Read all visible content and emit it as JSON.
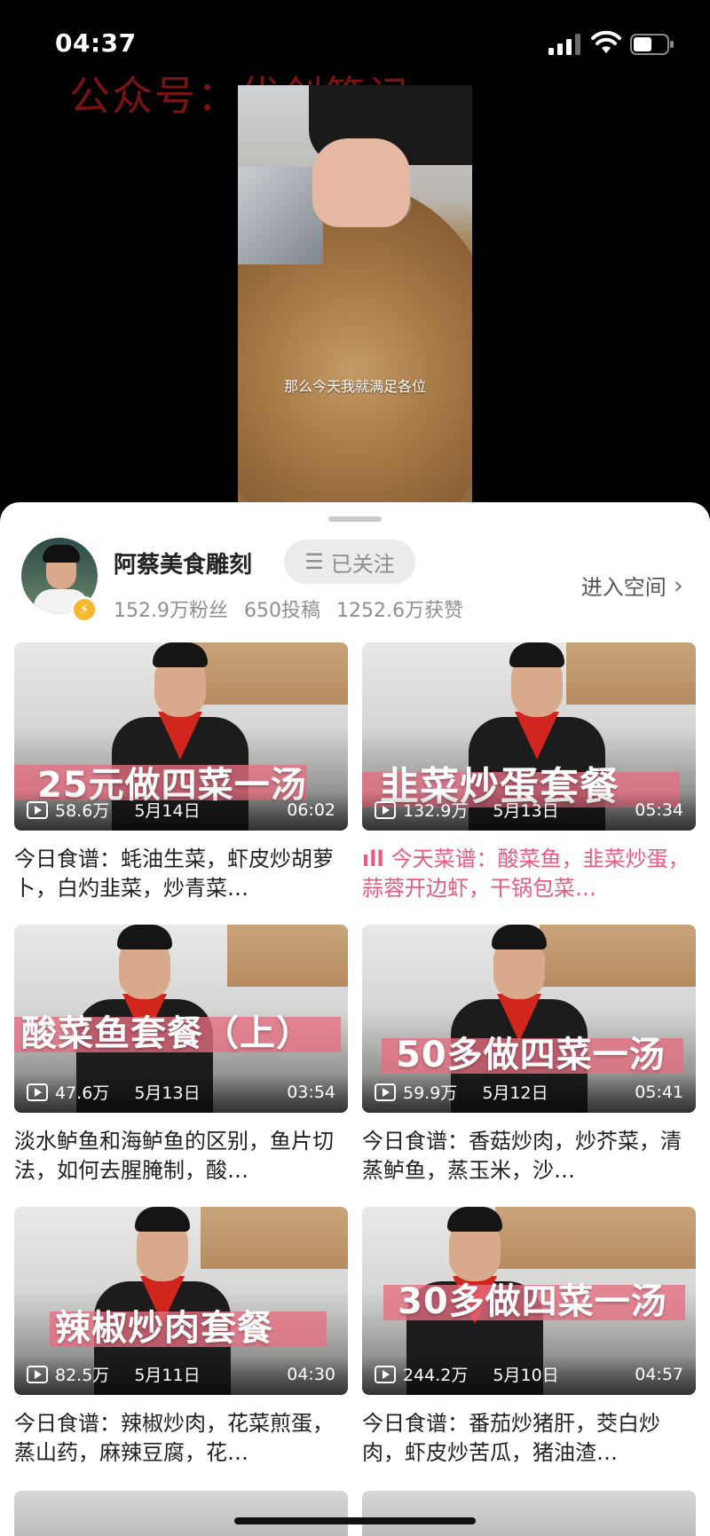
{
  "status": {
    "time": "04:37"
  },
  "watermark": "公众号：优创笔记",
  "video": {
    "subtitle": "那么今天我就满足各位"
  },
  "channel": {
    "name": "阿蔡美食雕刻",
    "follow_label": "已关注",
    "followers": "152.9万粉丝",
    "posts": "650投稿",
    "likes": "1252.6万获赞",
    "enter_space": "进入空间"
  },
  "videos": [
    {
      "overlay": "25元做四菜一汤",
      "views": "58.6万",
      "date": "5月14日",
      "duration": "06:02",
      "caption": "今日食谱：蚝油生菜，虾皮炒胡萝卜，白灼韭菜，炒青菜…",
      "active": false
    },
    {
      "overlay": "韭菜炒蛋套餐",
      "views": "132.9万",
      "date": "5月13日",
      "duration": "05:34",
      "caption": "今天菜谱：酸菜鱼，韭菜炒蛋，蒜蓉开边虾，干锅包菜…",
      "active": true
    },
    {
      "overlay": "酸菜鱼套餐（上）",
      "views": "47.6万",
      "date": "5月13日",
      "duration": "03:54",
      "caption": "淡水鲈鱼和海鲈鱼的区别，鱼片切法，如何去腥腌制，酸…",
      "active": false
    },
    {
      "overlay": "50多做四菜一汤",
      "views": "59.9万",
      "date": "5月12日",
      "duration": "05:41",
      "caption": "今日食谱：香菇炒肉，炒芥菜，清蒸鲈鱼，蒸玉米，沙…",
      "active": false
    },
    {
      "overlay": "辣椒炒肉套餐",
      "views": "82.5万",
      "date": "5月11日",
      "duration": "04:30",
      "caption": "今日食谱：辣椒炒肉，花菜煎蛋，蒸山药，麻辣豆腐，花…",
      "active": false
    },
    {
      "overlay": "30多做四菜一汤",
      "views": "244.2万",
      "date": "5月10日",
      "duration": "04:57",
      "caption": "今日食谱：番茄炒猪肝，茭白炒肉，虾皮炒苦瓜，猪油渣…",
      "active": false
    }
  ]
}
